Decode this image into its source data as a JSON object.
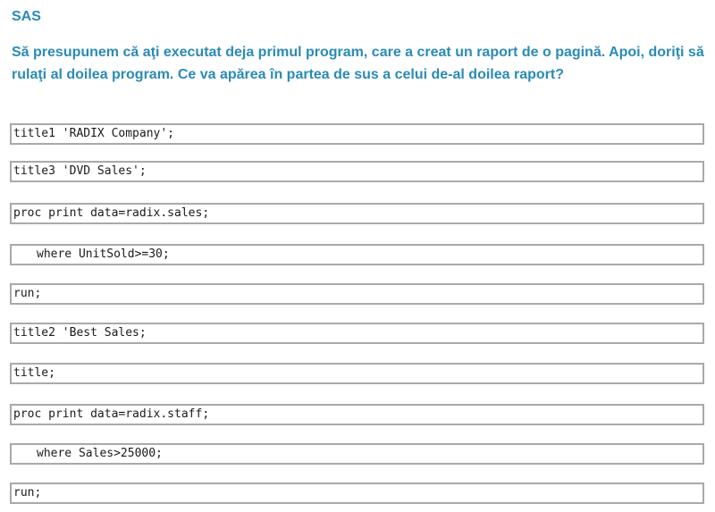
{
  "header": {
    "title": "SAS",
    "question": "Să presupunem că aţi executat deja primul program, care a creat un raport de o pagină. Apoi, doriţi să rulaţi al doilea program. Ce va apărea în partea de sus a celui de-al doilea raport?"
  },
  "code": {
    "lines": [
      "title1 'RADIX Company';",
      "title3 'DVD Sales';",
      "proc print data=radix.sales;",
      "where UnitSold>=30;",
      "run;",
      "title2 'Best Sales;",
      "title;",
      "proc print data=radix.staff;",
      "where Sales>25000;",
      "run;"
    ]
  },
  "colors": {
    "heading": "#2a8bb6",
    "box_border": "#a9a9a9",
    "code_text": "#1a1a1a"
  }
}
